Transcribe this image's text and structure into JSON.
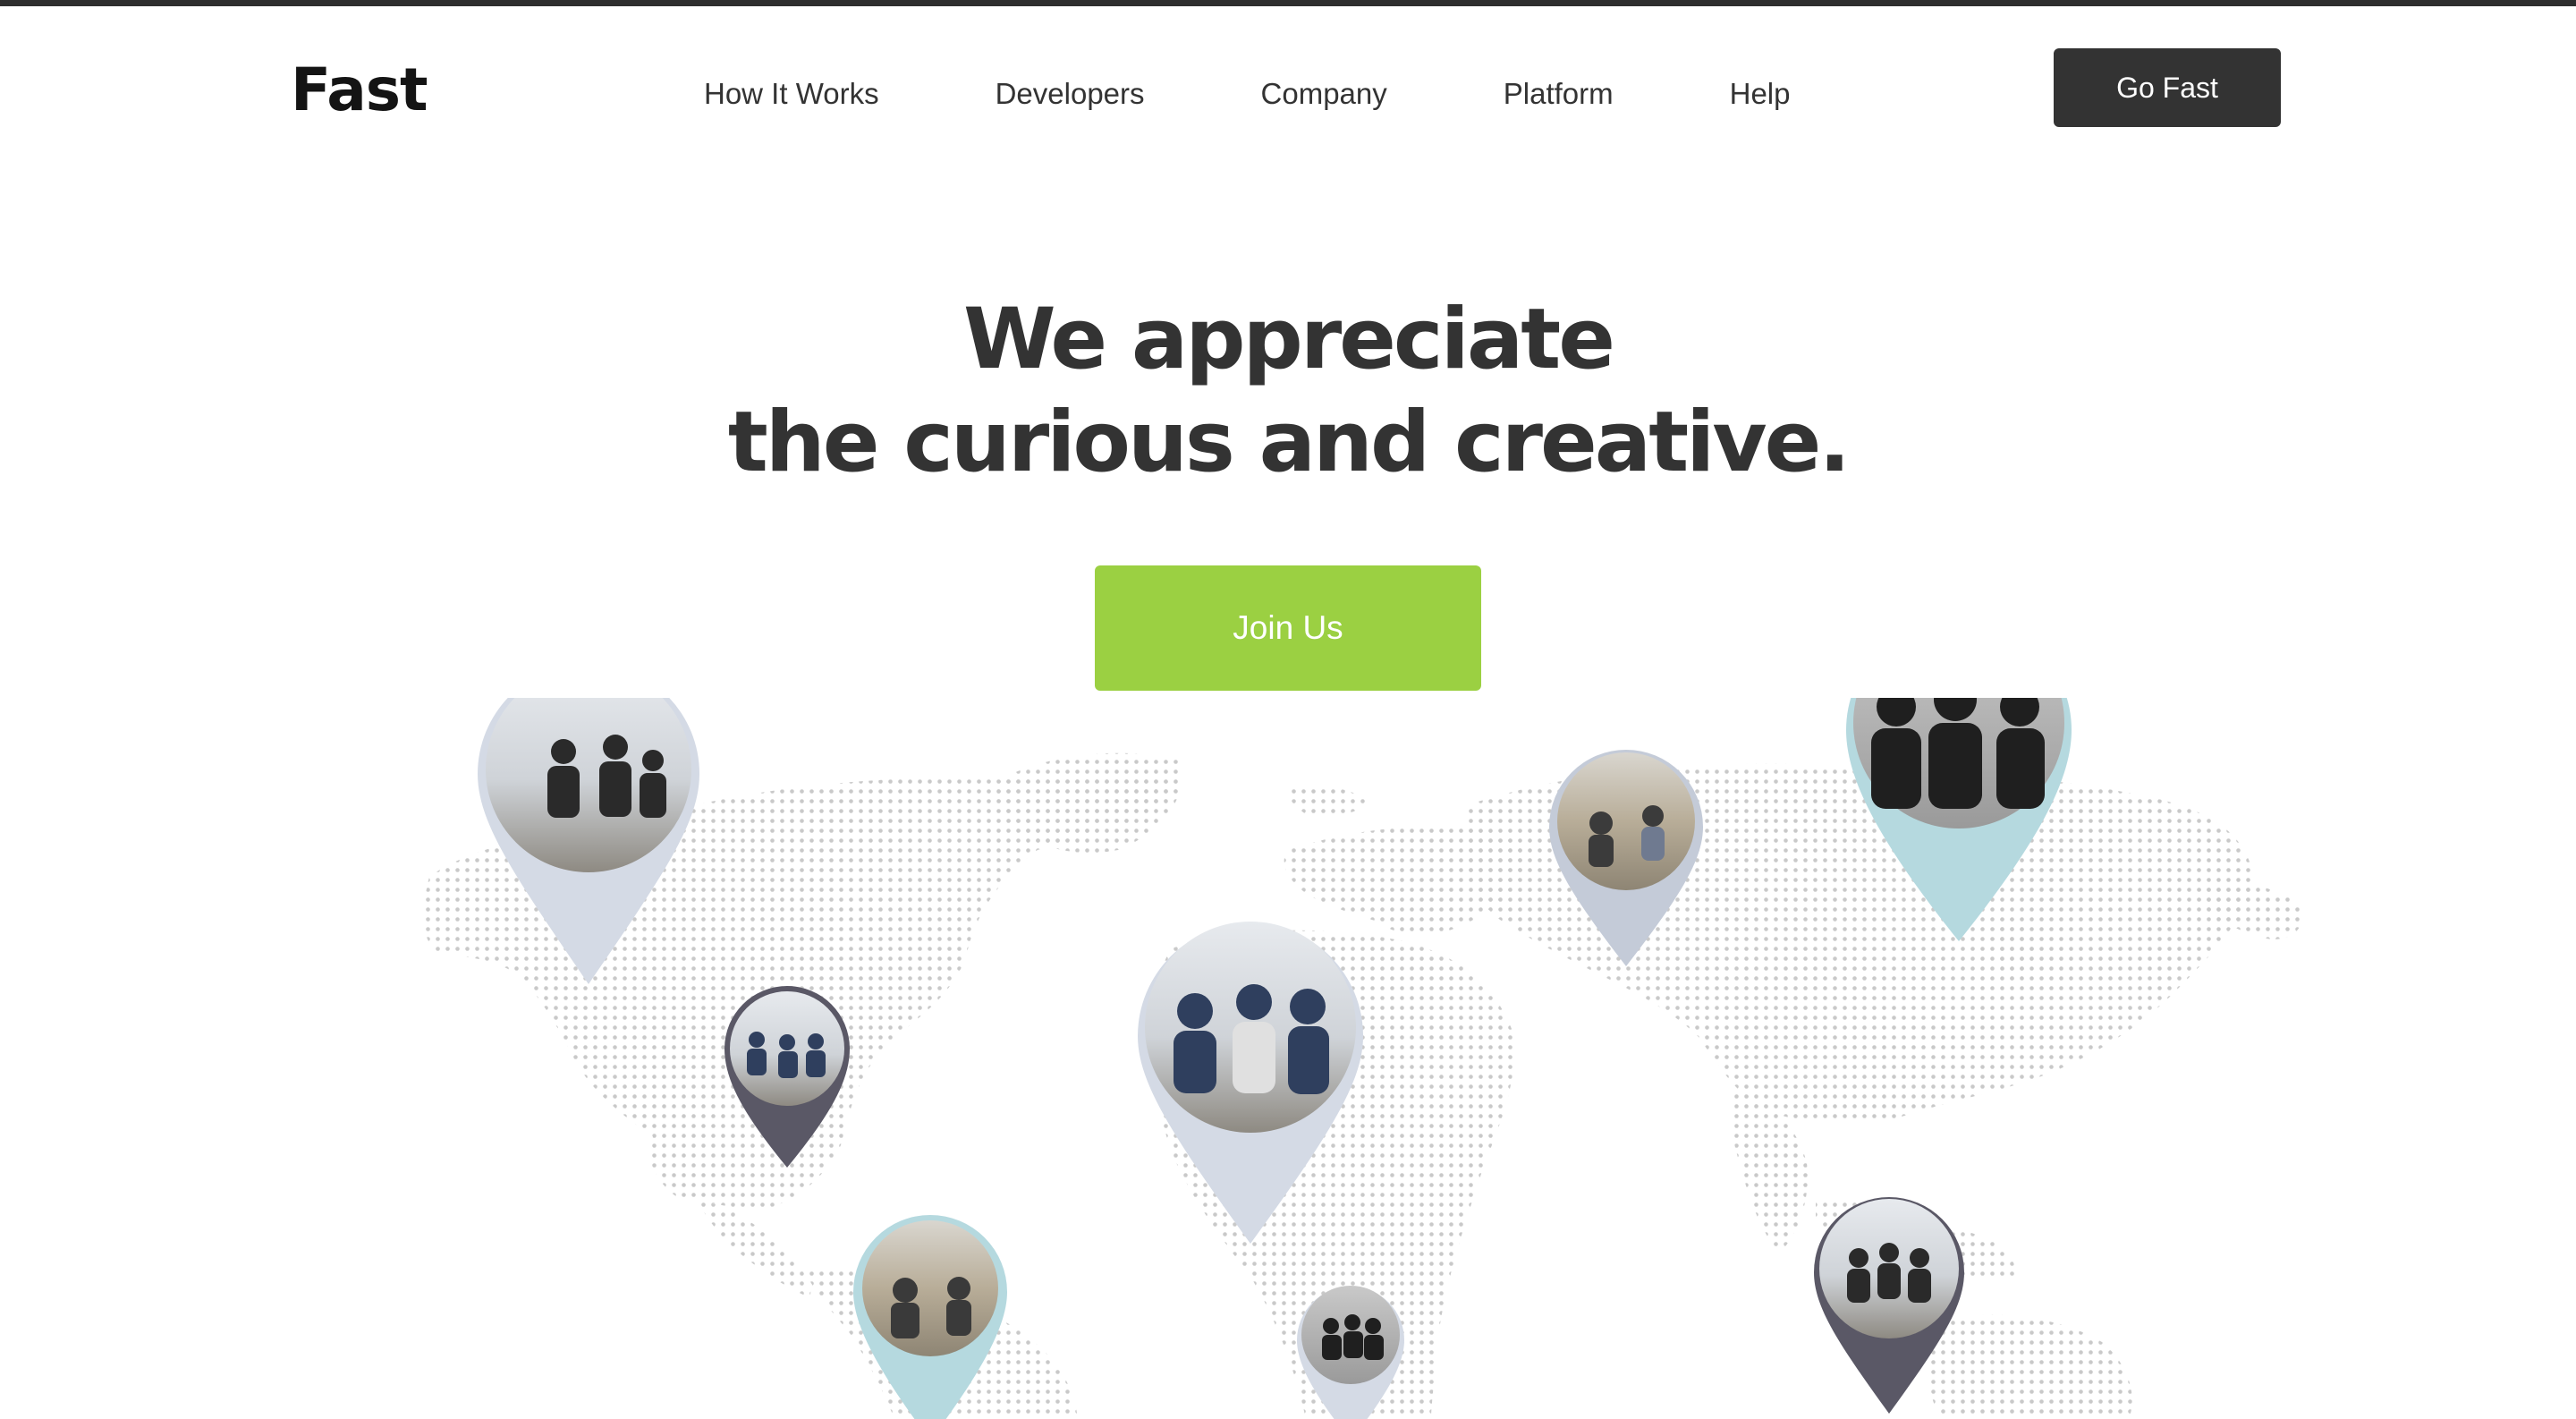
{
  "header": {
    "logo": "Fast",
    "nav": [
      {
        "label": "How It Works"
      },
      {
        "label": "Developers"
      },
      {
        "label": "Company"
      },
      {
        "label": "Platform"
      },
      {
        "label": "Help"
      }
    ],
    "cta_label": "Go Fast"
  },
  "hero": {
    "title_line1": "We appreciate",
    "title_line2": "the curious and creative.",
    "join_label": "Join Us"
  },
  "map": {
    "dot_color": "#c9c9c9",
    "pins": [
      {
        "name": "pin-north-america-large",
        "color": "#d4dae5",
        "photo": "group-jumping"
      },
      {
        "name": "pin-central-america",
        "color": "#5a5866",
        "photo": "group-sitting"
      },
      {
        "name": "pin-south-america",
        "color": "#b5d9df",
        "photo": "couple-field"
      },
      {
        "name": "pin-africa-large",
        "color": "#d4dae5",
        "photo": "trio-smiling"
      },
      {
        "name": "pin-south-africa",
        "color": "#d4dae5",
        "photo": "trio-dark"
      },
      {
        "name": "pin-russia",
        "color": "#c4cbd8",
        "photo": "couple-field"
      },
      {
        "name": "pin-east-asia-large",
        "color": "#b5d9df",
        "photo": "trio-portrait"
      },
      {
        "name": "pin-southeast-asia",
        "color": "#5a5866",
        "photo": "group-jumping"
      }
    ]
  },
  "colors": {
    "accent_green": "#9bd042",
    "dark": "#333333",
    "topbar": "#2e2e2e"
  }
}
